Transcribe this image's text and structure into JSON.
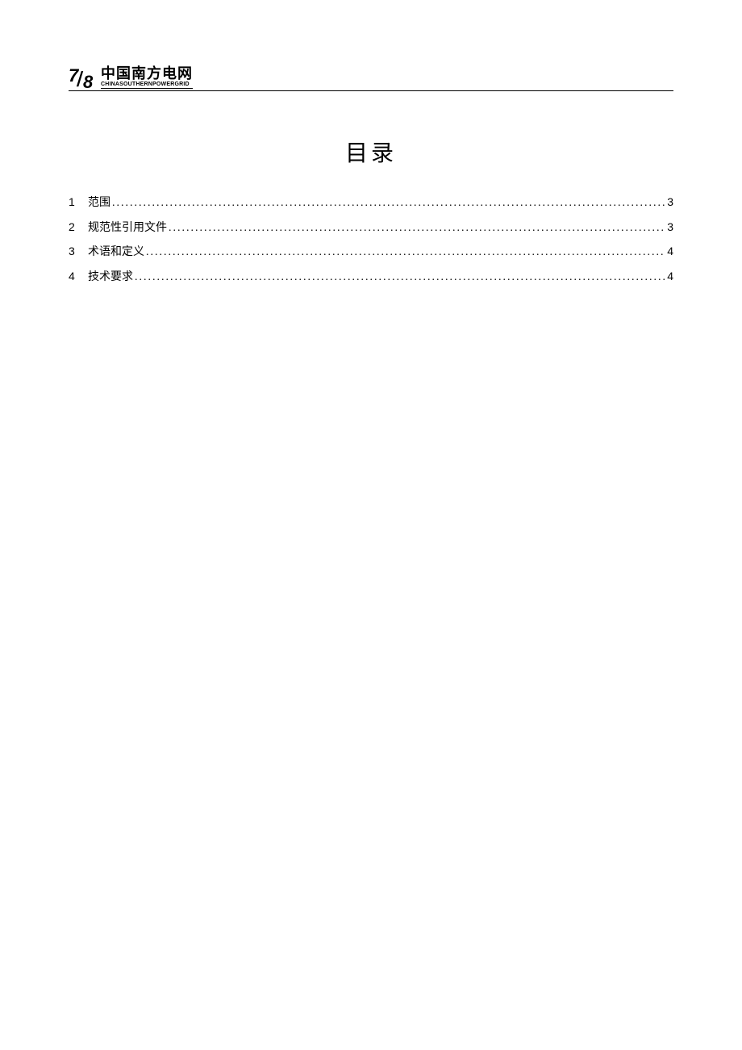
{
  "header": {
    "logo_fraction_top": "7",
    "logo_fraction_bottom": "8",
    "logo_cn": "中国南方电网",
    "logo_en": "CHINASOUTHERNPOWERGRID"
  },
  "toc": {
    "title": "目录",
    "items": [
      {
        "num": "1",
        "label": "范围",
        "page": "3"
      },
      {
        "num": "2",
        "label": "规范性引用文件",
        "page": "3"
      },
      {
        "num": "3",
        "label": "术语和定义",
        "page": "4"
      },
      {
        "num": "4",
        "label": "技术要求",
        "page": "4"
      }
    ]
  }
}
